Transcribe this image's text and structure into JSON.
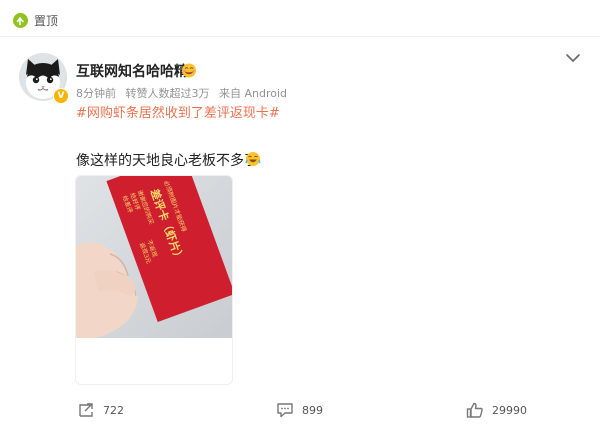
{
  "pin": {
    "label": "置顶"
  },
  "author": {
    "name": "互联网知名哈哈精"
  },
  "meta": {
    "time": "8分钟前",
    "reposts_text": "转赞人数超过3万",
    "source": "来自 Android"
  },
  "post": {
    "topic": "#网购虾条居然收到了差评返现卡#",
    "text": "像这样的天地良心老板不多了"
  },
  "image": {
    "card_title": "差评卡（虾片）",
    "card_lines": [
      "谢谢您的购买",
      "给好评",
      "不返现",
      "给差评",
      "返现3元",
      "必须附图片才能获得"
    ]
  },
  "actions": {
    "repost_count": "722",
    "comment_count": "899",
    "like_count": "29990"
  },
  "colors": {
    "topic": "#eb7350",
    "card_red": "#cf1f2e",
    "card_text": "#f5d86a",
    "verified_badge": "#f7b500"
  },
  "icons": [
    "pin-icon",
    "verified-badge-icon",
    "emoji-badge-icon",
    "chevron-down-icon",
    "laugh-emoji-icon",
    "repost-icon",
    "comment-icon",
    "like-icon"
  ]
}
